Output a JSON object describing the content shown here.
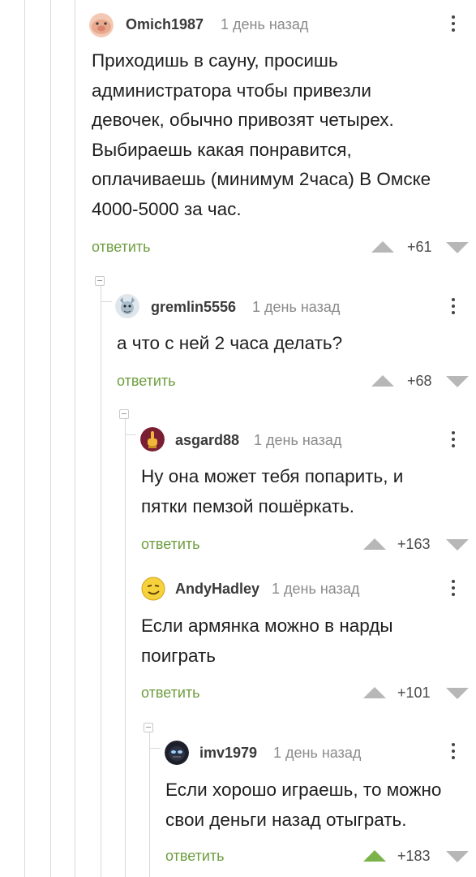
{
  "comments": [
    {
      "username": "Omich1987",
      "time": "1 день назад",
      "lines": [
        "Приходишь в сауну, просишь",
        "администратора чтобы привезли",
        "девочек, обычно привозят четырех.",
        "Выбираешь какая понравится,",
        "оплачиваешь (минимум 2часа) В Омске",
        "4000-5000 за час."
      ],
      "reply": "ответить",
      "score": "+61",
      "avatar": "pig-face-icon"
    },
    {
      "username": "gremlin5556",
      "time": "1 день назад",
      "lines": [
        "а что с ней 2 часа делать?"
      ],
      "reply": "ответить",
      "score": "+68",
      "avatar": "gremlin-icon"
    },
    {
      "username": "asgard88",
      "time": "1 день назад",
      "lines": [
        "Ну она может тебя попарить, и",
        "пятки пемзой пошёркать."
      ],
      "reply": "ответить",
      "score": "+163",
      "avatar": "raised-hand-icon"
    },
    {
      "username": "AndyHadley",
      "time": "1 день назад",
      "lines": [
        "Если армянка можно в нарды",
        "поиграть"
      ],
      "reply": "ответить",
      "score": "+101",
      "avatar": "smirk-face-icon"
    },
    {
      "username": "imv1979",
      "time": "1 день назад",
      "lines": [
        "Если хорошо играешь, то можно",
        "свои деньги назад отыграть."
      ],
      "reply": "ответить",
      "score": "+183",
      "upvoted": true,
      "avatar": "masked-face-icon"
    }
  ],
  "colors": {
    "reply_link": "#6e9d3f",
    "vote_active": "#7bb24a",
    "vote_idle": "#b7b7b7",
    "thread_line": "#d9d9d9"
  }
}
